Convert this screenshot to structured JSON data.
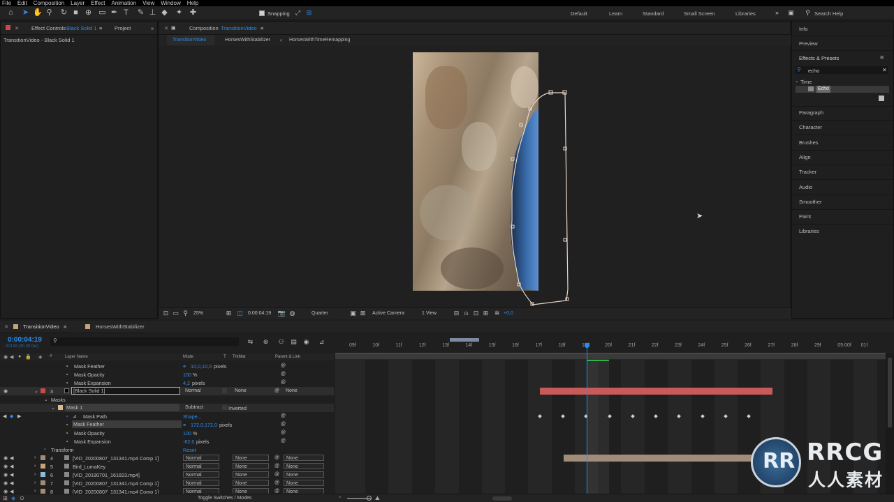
{
  "menu": [
    "File",
    "Edit",
    "Composition",
    "Layer",
    "Effect",
    "Animation",
    "View",
    "Window",
    "Help"
  ],
  "toolbar": {
    "snapping_label": "Snapping",
    "search_help": "Search Help"
  },
  "workspaces": [
    "Default",
    "Learn",
    "Standard",
    "Small Screen",
    "Libraries"
  ],
  "left_panel": {
    "tab_effect_controls": "Effect Controls",
    "tab_effect_layer": "Black Solid 1",
    "tab_project": "Project",
    "subtitle": "TransitionVideo - Black Solid 1"
  },
  "comp_panel": {
    "tab_label": "Composition",
    "tab_comp": "TransitionVideo",
    "flow": [
      "TransitionVideo",
      "HorsesWithStabilizer",
      "HorsesWithTimeRemapping"
    ],
    "zoom": "25%",
    "timecode": "0:00:04:19",
    "resolution": "Quarter",
    "camera": "Active Camera",
    "views": "1 View",
    "exposure": "+0,0"
  },
  "right_panel": {
    "items_top": [
      "Info",
      "Preview"
    ],
    "effects_presets": "Effects & Presets",
    "search_value": "echo",
    "category": "Time",
    "result": "Echo",
    "items_bottom": [
      "Paragraph",
      "Character",
      "Brushes",
      "Align",
      "Tracker",
      "Audio",
      "Smoother",
      "Paint",
      "Libraries"
    ]
  },
  "timeline": {
    "tab_active": "TransitionVideo",
    "tab_other": "HorsesWithStabilizer",
    "timecode": "0:00:04:19",
    "sub_timecode": "00139 (30.00 fps)",
    "col_layer_name": "Layer Name",
    "col_mode": "Mode",
    "col_t": "T",
    "col_trkmat": "TrkMat",
    "col_parent": "Parent & Link",
    "ruler": [
      "09f",
      "10f",
      "11f",
      "12f",
      "13f",
      "14f",
      "15f",
      "16f",
      "17f",
      "18f",
      "19f",
      "20f",
      "21f",
      "22f",
      "23f",
      "24f",
      "25f",
      "26f",
      "27f",
      "28f",
      "29f",
      "05:00f",
      "01f"
    ],
    "rows": [
      {
        "name": "Mask Feather",
        "value": "10,0,10,0",
        "unit": "pixels"
      },
      {
        "name": "Mask Opacity",
        "value": "100",
        "unit": "%"
      },
      {
        "name": "Mask Expansion",
        "value": "4,2",
        "unit": "pixels"
      },
      {
        "num": "3",
        "name": "[Black Solid 1]",
        "mode": "Normal",
        "trkmat": "None",
        "parent": "None"
      },
      {
        "name": "Masks"
      },
      {
        "name": "Mask 1",
        "mode": "Subtract",
        "extra": "Inverted"
      },
      {
        "name": "Mask Path",
        "value": "Shape..."
      },
      {
        "name": "Mask Feather",
        "value": "172,0,172,0",
        "unit": "pixels"
      },
      {
        "name": "Mask Opacity",
        "value": "100",
        "unit": "%"
      },
      {
        "name": "Mask Expansion",
        "value": "-82,0",
        "unit": "pixels"
      },
      {
        "name": "Transform",
        "value": "Reset"
      },
      {
        "num": "4",
        "name": "[VID_20200807_131341.mp4 Comp 1]",
        "mode": "Normal",
        "trkmat": "None",
        "parent": "None"
      },
      {
        "num": "5",
        "name": "Bird_LumaKey",
        "mode": "Normal",
        "trkmat": "None",
        "parent": "None"
      },
      {
        "num": "6",
        "name": "[VID_20190701_161823.mp4]",
        "mode": "Normal",
        "trkmat": "None",
        "parent": "None"
      },
      {
        "num": "7",
        "name": "[VID_20200807_131341.mp4 Comp 1]",
        "mode": "Normal",
        "trkmat": "None",
        "parent": "None"
      },
      {
        "num": "8",
        "name": "[VID_20200807_131341.mp4 Comp 1]",
        "mode": "Normal",
        "trkmat": "None",
        "parent": "None"
      }
    ],
    "footer": "Toggle Switches / Modes"
  },
  "watermark": {
    "brand": "RRCG",
    "sub": "人人素材"
  },
  "colors": {
    "accent": "#2d8ceb",
    "layer_red": "#c85a5a",
    "layer_tan": "#a08c78",
    "timeline_green": "#2fb34b"
  }
}
